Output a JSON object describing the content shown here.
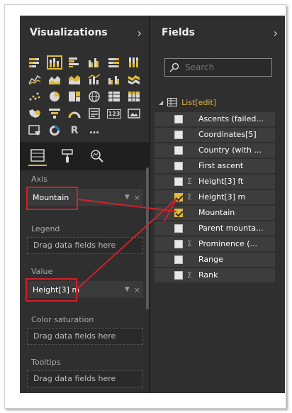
{
  "visualizations": {
    "title": "Visualizations",
    "icons": [
      "stacked-bar-icon",
      "stacked-column-icon",
      "clustered-bar-icon",
      "clustered-column-icon",
      "100-stacked-bar-icon",
      "100-stacked-column-icon",
      "line-chart-icon",
      "area-chart-icon",
      "stacked-area-icon",
      "line-column-icon",
      "line-clustered-column-icon",
      "ribbon-chart-icon",
      "scatter-chart-icon",
      "pie-chart-icon",
      "treemap-icon",
      "globe-map-icon",
      "table-icon",
      "matrix-icon",
      "filled-map-icon",
      "funnel-icon",
      "gauge-icon",
      "multi-row-card-icon",
      "card-icon",
      "image-icon",
      "slicer-icon",
      "donut-icon",
      "r-script-icon",
      "more-icon"
    ],
    "r_label": "R",
    "more_label": "…",
    "card_label": "123",
    "tools": [
      "fields-tool-icon",
      "format-paint-icon",
      "analytics-icon"
    ],
    "wells": {
      "axis": {
        "label": "Axis",
        "field": "Mountain"
      },
      "legend": {
        "label": "Legend",
        "placeholder": "Drag data fields here"
      },
      "value": {
        "label": "Value",
        "field": "Height[3] m"
      },
      "color_saturation": {
        "label": "Color saturation",
        "placeholder": "Drag data fields here"
      },
      "tooltips": {
        "label": "Tooltips",
        "placeholder": "Drag data fields here"
      }
    }
  },
  "fields": {
    "title": "Fields",
    "search_placeholder": "Search",
    "table_name": "List[edit]",
    "items": [
      {
        "name": "Ascents (failed...",
        "checked": false,
        "sigma": false
      },
      {
        "name": "Coordinates[5]",
        "checked": false,
        "sigma": false
      },
      {
        "name": "Country (with ...",
        "checked": false,
        "sigma": false
      },
      {
        "name": "First ascent",
        "checked": false,
        "sigma": false
      },
      {
        "name": "Height[3] ft",
        "checked": false,
        "sigma": true
      },
      {
        "name": "Height[3] m",
        "checked": true,
        "sigma": true
      },
      {
        "name": "Mountain",
        "checked": true,
        "sigma": false
      },
      {
        "name": "Parent mounta...",
        "checked": false,
        "sigma": false
      },
      {
        "name": "Prominence (...",
        "checked": false,
        "sigma": true
      },
      {
        "name": "Range",
        "checked": false,
        "sigma": false
      },
      {
        "name": "Rank",
        "checked": false,
        "sigma": true
      }
    ]
  },
  "colors": {
    "accent": "#e0b93b",
    "callout": "#d0202c",
    "pane_bg": "#2f2f2f"
  }
}
